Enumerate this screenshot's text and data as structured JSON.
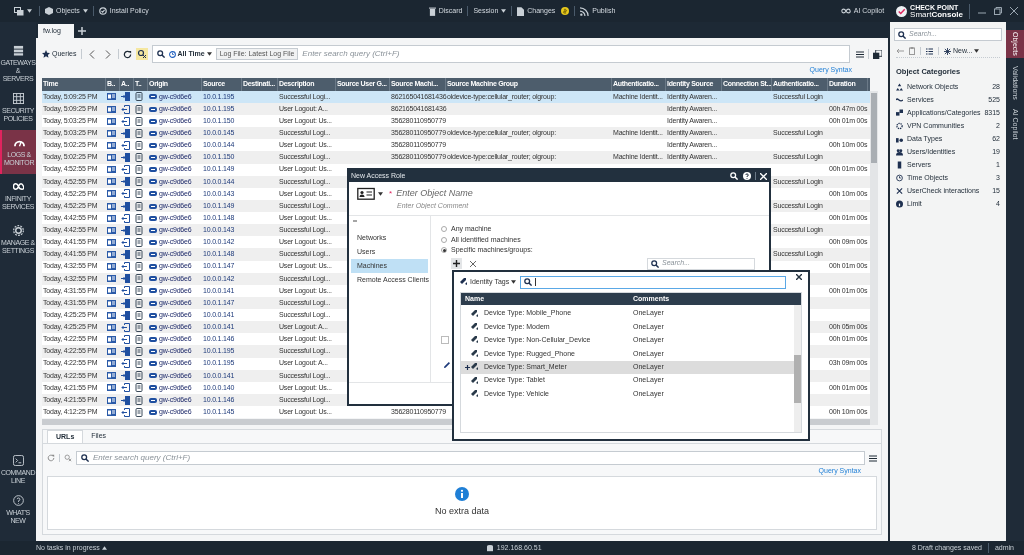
{
  "top_bar": {
    "objects": "Objects",
    "install_policy": "Install Policy",
    "discard": "Discard",
    "session": "Session",
    "changes": "Changes",
    "publish": "Publish",
    "ai_copilot": "AI Copilot",
    "brand": "CHECK POINT",
    "product": "Smart**Console**"
  },
  "sidebar": {
    "items": [
      {
        "label": "GATEWAYS & SERVERS",
        "selected": false
      },
      {
        "label": "SECURITY POLICIES",
        "selected": false
      },
      {
        "label": "LOGS & MONITOR",
        "selected": true
      },
      {
        "label": "INFINITY SERVICES",
        "selected": false
      },
      {
        "label": "MANAGE & SETTINGS",
        "selected": false
      }
    ],
    "bottom_items": [
      {
        "label": "COMMAND LINE"
      },
      {
        "label": "WHAT'S NEW"
      }
    ]
  },
  "log_tabs": [
    {
      "label": "fw.log",
      "selected": true
    }
  ],
  "toolbar": {
    "queries": "Queries",
    "time_filter": "All Time",
    "log_file_chip": "Log File: Latest Log File",
    "search_placeholder": "Enter search query (Ctrl+F)",
    "query_syntax": "Query Syntax"
  },
  "table": {
    "columns": [
      "Time",
      "B..",
      "A..",
      "T..",
      "Origin",
      "Source",
      "Destinati...",
      "Description",
      "Source User G...",
      "Source Machi...",
      "Source Machine Group",
      "Authenticatio...",
      "Identity Source",
      "Connection St...",
      "Authenticatio...",
      "Duration"
    ],
    "rows": [
      {
        "selected": true,
        "time": "Today, 5:09:25 PM",
        "kind": "login",
        "origin": "gw-c9d6e6",
        "source": "10.0.1.195",
        "description": "Successful Logi...",
        "source_machine": "862165041681436",
        "machine_group": "oldevice-type:cellular_router; olgroup:",
        "auth_method": "Machine Identit...",
        "identity_source": "Identity Awaren...",
        "auth_result": "Successful Login"
      },
      {
        "selected": false,
        "time": "Today, 5:09:25 PM",
        "kind": "logout",
        "origin": "gw-c9d6e6",
        "source": "10.0.1.195",
        "description": "User Logout: A...",
        "source_machine": "862165041681436",
        "identity_source": "Identity Awaren...",
        "duration": "00h 47m 00s"
      },
      {
        "selected": false,
        "time": "Today, 5:03:25 PM",
        "kind": "logout",
        "origin": "gw-c9d6e6",
        "source": "10.0.1.150",
        "description": "User Logout: Us...",
        "source_machine": "356280110950779",
        "identity_source": "Identity Awaren...",
        "duration": "00h 01m 00s"
      },
      {
        "selected": false,
        "time": "Today, 5:03:25 PM",
        "kind": "login",
        "origin": "gw-c9d6e6",
        "source": "10.0.0.145",
        "description": "Successful Logi...",
        "source_machine": "356280110950779",
        "machine_group": "oldevice-type:cellular_router; olgroup:",
        "auth_method": "Machine Identit...",
        "identity_source": "Identity Awaren...",
        "auth_result": "Successful Login"
      },
      {
        "selected": false,
        "time": "Today, 5:02:25 PM",
        "kind": "logout",
        "origin": "gw-c9d6e6",
        "source": "10.0.0.144",
        "description": "User Logout: Us...",
        "source_machine": "356280110950779",
        "identity_source": "Identity Awaren...",
        "duration": "00h 10m 00s"
      },
      {
        "selected": false,
        "time": "Today, 5:02:25 PM",
        "kind": "login",
        "origin": "gw-c9d6e6",
        "source": "10.0.1.150",
        "description": "Successful Logi...",
        "source_machine": "356280110950779",
        "machine_group": "oldevice-type:cellular_router; olgroup:",
        "auth_method": "Machine Identit...",
        "identity_source": "Identity Awaren...",
        "auth_result": "Successful Login"
      },
      {
        "selected": false,
        "time": "Today, 4:52:55 PM",
        "kind": "logout",
        "origin": "gw-c9d6e6",
        "source": "10.0.1.149",
        "description": "User Logout: Us...",
        "duration": "00h 01m 00s"
      },
      {
        "selected": false,
        "time": "Today, 4:52:55 PM",
        "kind": "login",
        "origin": "gw-c9d6e6",
        "source": "10.0.0.144",
        "description": "Successful Logi...",
        "auth_result": "Successful Login"
      },
      {
        "selected": false,
        "time": "Today, 4:52:25 PM",
        "kind": "logout",
        "origin": "gw-c9d6e6",
        "source": "10.0.0.143",
        "description": "User Logout: Us...",
        "duration": "00h 10m 00s"
      },
      {
        "selected": false,
        "time": "Today, 4:52:25 PM",
        "kind": "login",
        "origin": "gw-c9d6e6",
        "source": "10.0.1.149",
        "description": "Successful Logi...",
        "auth_result": "Successful Login"
      },
      {
        "selected": false,
        "time": "Today, 4:42:55 PM",
        "kind": "logout",
        "origin": "gw-c9d6e6",
        "source": "10.0.1.148",
        "description": "User Logout: Us...",
        "duration": "00h 01m 00s"
      },
      {
        "selected": false,
        "time": "Today, 4:42:55 PM",
        "kind": "login",
        "origin": "gw-c9d6e6",
        "source": "10.0.0.143",
        "description": "Successful Logi...",
        "auth_result": "Successful Login"
      },
      {
        "selected": false,
        "time": "Today, 4:41:55 PM",
        "kind": "logout",
        "origin": "gw-c9d6e6",
        "source": "10.0.0.142",
        "description": "User Logout: Us...",
        "duration": "00h 09m 00s"
      },
      {
        "selected": false,
        "time": "Today, 4:41:55 PM",
        "kind": "login",
        "origin": "gw-c9d6e6",
        "source": "10.0.1.148",
        "description": "Successful Logi...",
        "auth_result": "Successful Login"
      },
      {
        "selected": false,
        "time": "Today, 4:32:55 PM",
        "kind": "logout",
        "origin": "gw-c9d6e6",
        "source": "10.0.1.147",
        "description": "User Logout: Us...",
        "duration": "00h 01m 00s"
      },
      {
        "selected": false,
        "time": "Today, 4:32:55 PM",
        "kind": "login",
        "origin": "gw-c9d6e6",
        "source": "10.0.0.142",
        "description": "Successful Logi..."
      },
      {
        "selected": false,
        "time": "Today, 4:31:55 PM",
        "kind": "logout",
        "origin": "gw-c9d6e6",
        "source": "10.0.0.141",
        "description": "User Logout: Us...",
        "duration": "00h 01m 00s"
      },
      {
        "selected": false,
        "time": "Today, 4:31:55 PM",
        "kind": "login",
        "origin": "gw-c9d6e6",
        "source": "10.0.1.147",
        "description": "Successful Logi..."
      },
      {
        "selected": false,
        "time": "Today, 4:25:25 PM",
        "kind": "login",
        "origin": "gw-c9d6e6",
        "source": "10.0.0.141",
        "description": "Successful Logi..."
      },
      {
        "selected": false,
        "time": "Today, 4:25:25 PM",
        "kind": "logout",
        "origin": "gw-c9d6e6",
        "source": "10.0.0.141",
        "description": "User Logout: A...",
        "duration": "00h 05m 00s"
      },
      {
        "selected": false,
        "time": "Today, 4:22:55 PM",
        "kind": "logout",
        "origin": "gw-c9d6e6",
        "source": "10.0.1.146",
        "description": "User Logout: Us...",
        "duration": "00h 01m 00s"
      },
      {
        "selected": false,
        "time": "Today, 4:22:55 PM",
        "kind": "login",
        "origin": "gw-c9d6e6",
        "source": "10.0.1.195",
        "description": "Successful Logi..."
      },
      {
        "selected": false,
        "time": "Today, 4:22:55 PM",
        "kind": "logout",
        "origin": "gw-c9d6e6",
        "source": "10.0.1.195",
        "description": "User Logout: A...",
        "duration": "03h 09m 00s"
      },
      {
        "selected": false,
        "time": "Today, 4:22:55 PM",
        "kind": "login",
        "origin": "gw-c9d6e6",
        "source": "10.0.0.141",
        "description": "Successful Logi..."
      },
      {
        "selected": false,
        "time": "Today, 4:21:55 PM",
        "kind": "logout",
        "origin": "gw-c9d6e6",
        "source": "10.0.0.140",
        "description": "User Logout: Us...",
        "duration": "00h 01m 00s"
      },
      {
        "selected": false,
        "time": "Today, 4:21:55 PM",
        "kind": "login",
        "origin": "gw-c9d6e6",
        "source": "10.0.1.146",
        "description": "Successful Logi..."
      },
      {
        "selected": false,
        "time": "Today, 4:12:25 PM",
        "kind": "logout",
        "origin": "gw-c9d6e6",
        "source": "10.0.1.145",
        "description": "User Logout: Us...",
        "source_machine": "356280110950779",
        "duration": "00h 10m 00s"
      }
    ]
  },
  "details": {
    "tabs": [
      {
        "label": "URLs",
        "selected": true
      },
      {
        "label": "Files",
        "selected": false
      }
    ],
    "search_placeholder": "Enter search query (Ctrl+F)",
    "query_syntax": "Query Syntax",
    "empty_message": "No extra data"
  },
  "dialog": {
    "title": "New Access Role",
    "required_mark": "*",
    "name_placeholder": "Enter Object Name",
    "comment_placeholder": "Enter Object Comment",
    "nav": [
      {
        "label": "Networks",
        "selected": false
      },
      {
        "label": "Users",
        "selected": false
      },
      {
        "label": "Machines",
        "selected": true
      },
      {
        "label": "Remote Access Clients",
        "selected": false
      }
    ],
    "options": [
      {
        "label": "Any machine",
        "selected": false
      },
      {
        "label": "All identified machines",
        "selected": false
      },
      {
        "label": "Specific machines/groups:",
        "selected": true
      }
    ],
    "search_placeholder": "Search...",
    "checkbox": {
      "checked": false
    }
  },
  "picker": {
    "filter": "Identity Tags",
    "columns": [
      "Name",
      "Comments"
    ],
    "rows": [
      {
        "name": "Device Type: Mobile_Phone",
        "comment": "OneLayer",
        "selected": false
      },
      {
        "name": "Device Type: Modem",
        "comment": "OneLayer",
        "selected": false
      },
      {
        "name": "Device Type: Non-Cellular_Device",
        "comment": "OneLayer",
        "selected": false
      },
      {
        "name": "Device Type: Rugged_Phone",
        "comment": "OneLayer",
        "selected": false
      },
      {
        "name": "Device Type: Smart_Meter",
        "comment": "OneLayer",
        "selected": true
      },
      {
        "name": "Device Type: Tablet",
        "comment": "OneLayer",
        "selected": false
      },
      {
        "name": "Device Type: Vehicle",
        "comment": "OneLayer",
        "selected": false
      }
    ]
  },
  "objects_panel": {
    "search_placeholder": "Search...",
    "new_button": "New...",
    "heading": "Object Categories",
    "categories": [
      {
        "name": "Network Objects",
        "count": "28"
      },
      {
        "name": "Services",
        "count": "525"
      },
      {
        "name": "Applications/Categories",
        "count": "8315"
      },
      {
        "name": "VPN Communities",
        "count": "2"
      },
      {
        "name": "Data Types",
        "count": "62"
      },
      {
        "name": "Users/Identities",
        "count": "19"
      },
      {
        "name": "Servers",
        "count": "1"
      },
      {
        "name": "Time Objects",
        "count": "3"
      },
      {
        "name": "UserCheck interactions",
        "count": "15"
      },
      {
        "name": "Limit",
        "count": "4"
      }
    ]
  },
  "right_tabs": [
    {
      "label": "Objects",
      "selected": true
    },
    {
      "label": "Validations",
      "selected": false
    },
    {
      "label": "AI Copilot",
      "selected": false
    }
  ],
  "status_bar": {
    "tasks": "No tasks in progress",
    "server": "192.168.60.51",
    "draft": "8 Draft changes saved",
    "user": "admin"
  }
}
